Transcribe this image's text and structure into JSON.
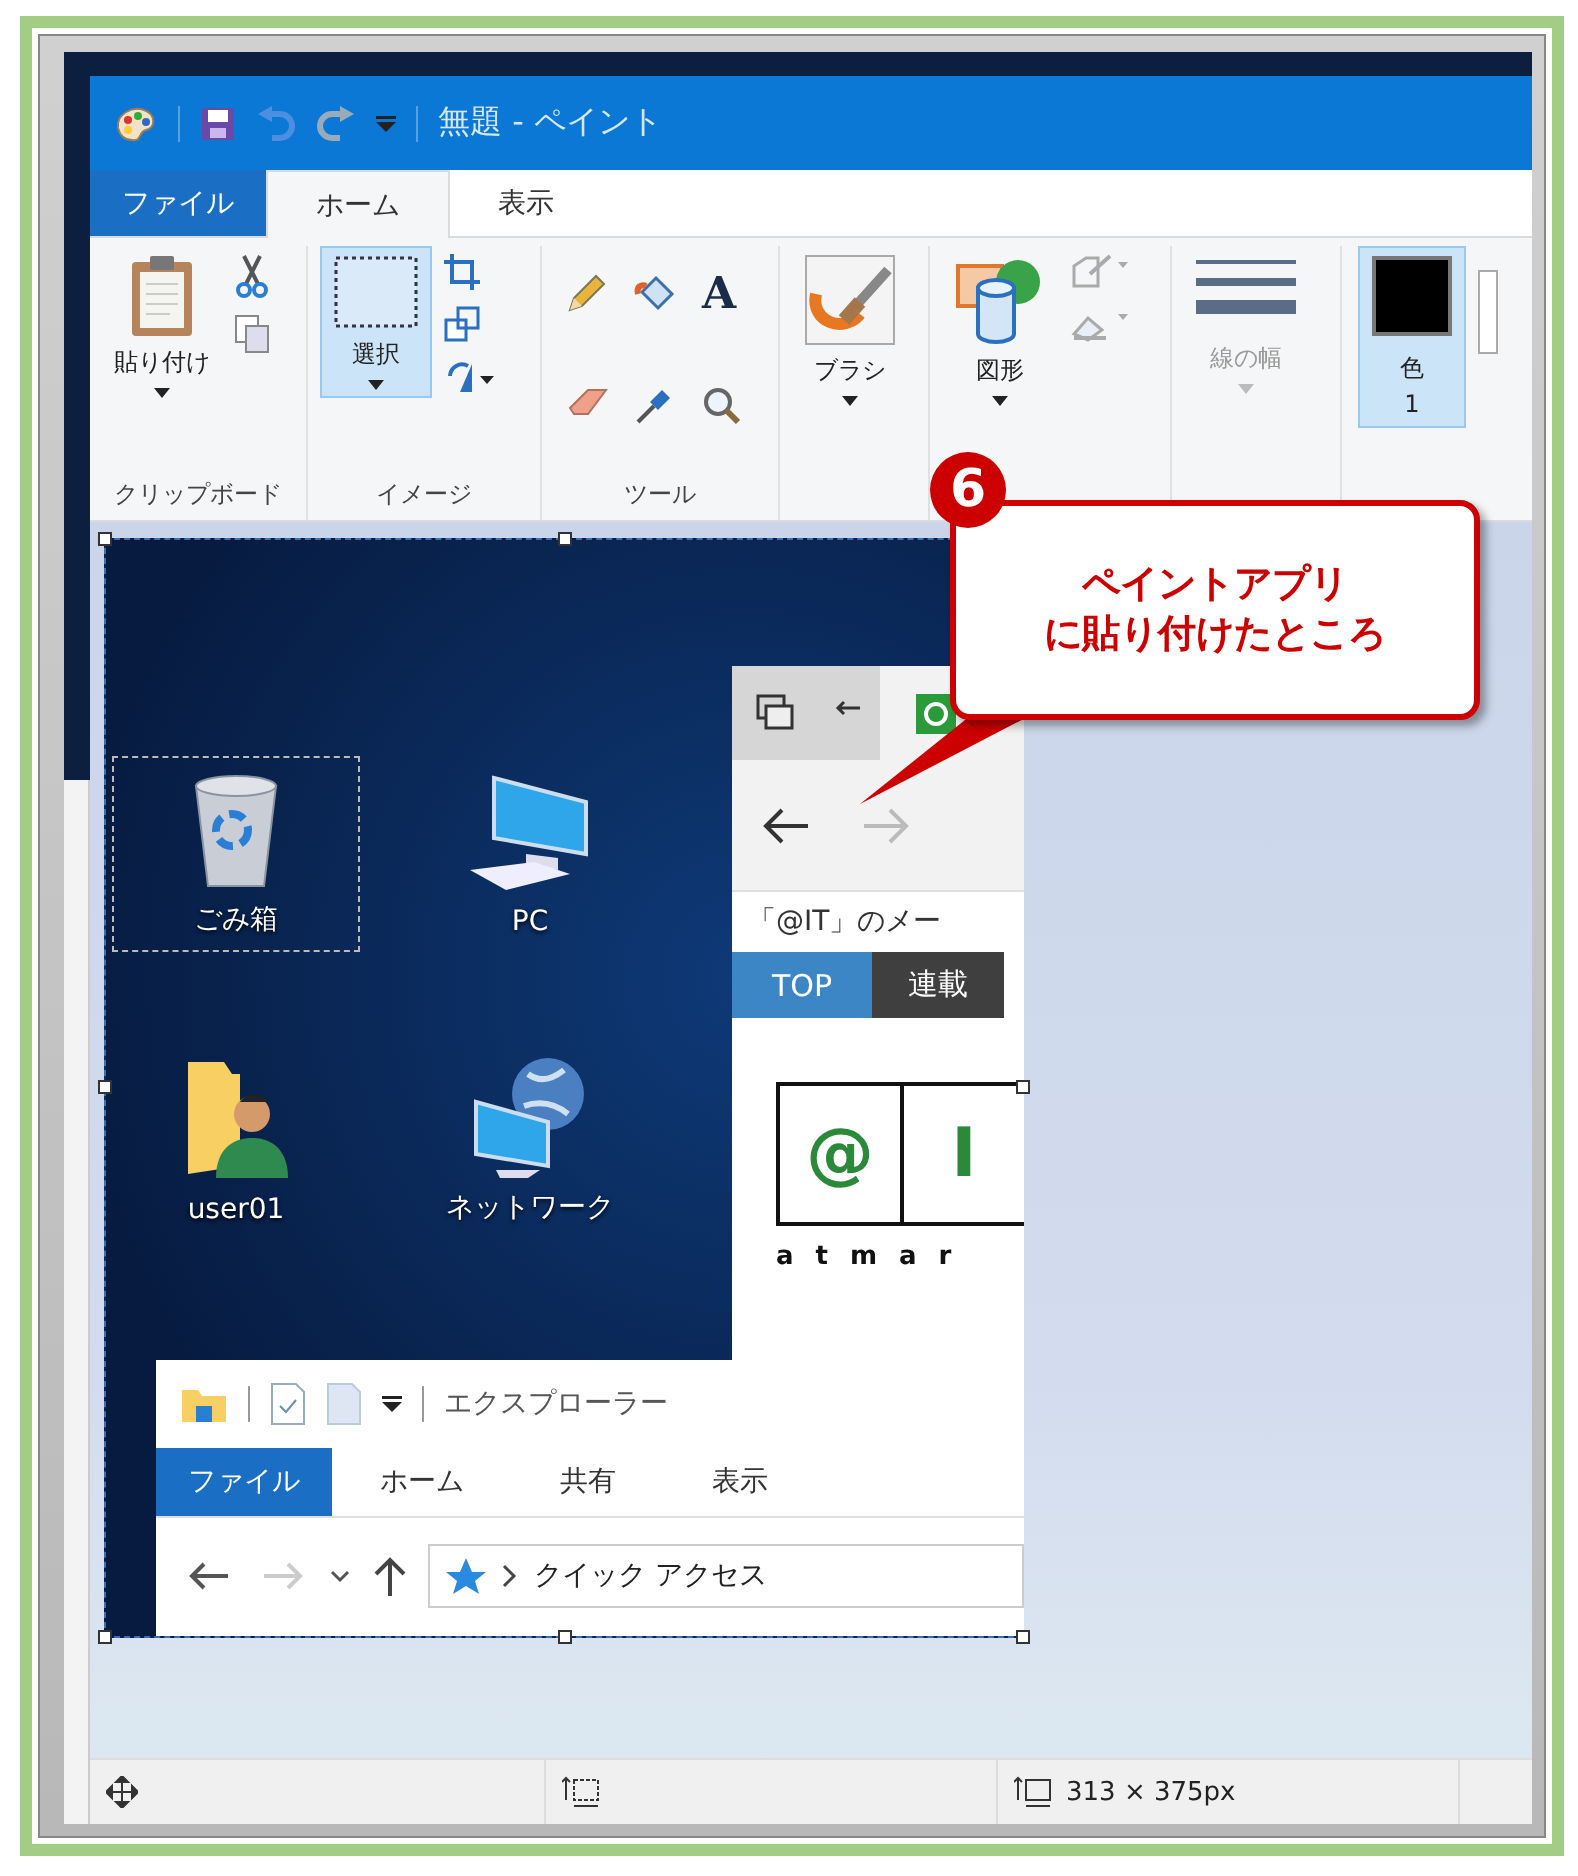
{
  "window": {
    "title": "無題 - ペイント"
  },
  "tabs": [
    {
      "label": "ファイル",
      "kind": "file",
      "selected": false
    },
    {
      "label": "ホーム",
      "kind": "tab",
      "selected": true
    },
    {
      "label": "表示",
      "kind": "tab",
      "selected": false
    }
  ],
  "ribbon": {
    "groups": [
      {
        "kind": "clipboard",
        "label": "クリップボード",
        "button": "貼り付け",
        "selected": false
      },
      {
        "kind": "image",
        "label": "イメージ",
        "button": "選択",
        "selected": true
      },
      {
        "kind": "tools",
        "label": "ツール",
        "glyph": "A",
        "selected": false
      },
      {
        "kind": "brush",
        "button": "ブラシ",
        "selected": false
      },
      {
        "kind": "shapes",
        "button": "図形",
        "selected": false
      },
      {
        "kind": "size",
        "button": "線の幅",
        "disabled": true,
        "selected": false
      },
      {
        "kind": "color",
        "button": "色",
        "sub": "1",
        "selected": true
      }
    ]
  },
  "canvas": {
    "desktop_icons": [
      {
        "label": "ごみ箱",
        "kind": "trash",
        "selected": true
      },
      {
        "label": "PC",
        "kind": "pc",
        "selected": false
      },
      {
        "label": "user01",
        "kind": "user",
        "selected": false
      },
      {
        "label": "ネットワーク",
        "kind": "network",
        "selected": false
      }
    ],
    "browser": {
      "page_title": "「@IT」のメー",
      "nav": [
        {
          "label": "TOP",
          "selected": true
        },
        {
          "label": "連載",
          "selected": false
        }
      ],
      "logo": [
        "@",
        "I"
      ],
      "logo_text": "atmar"
    },
    "explorer": {
      "title": "エクスプローラー",
      "tabs": [
        {
          "label": "ファイル",
          "kind": "file"
        },
        {
          "label": "ホーム",
          "kind": "tab"
        },
        {
          "label": "共有",
          "kind": "tab"
        },
        {
          "label": "表示",
          "kind": "tab"
        }
      ],
      "address": "クイック アクセス"
    }
  },
  "status_bar": {
    "size": "313 × 375px"
  },
  "callout": {
    "step": "6",
    "lines": [
      "ペイントアプリ",
      "に貼り付けたところ"
    ]
  }
}
